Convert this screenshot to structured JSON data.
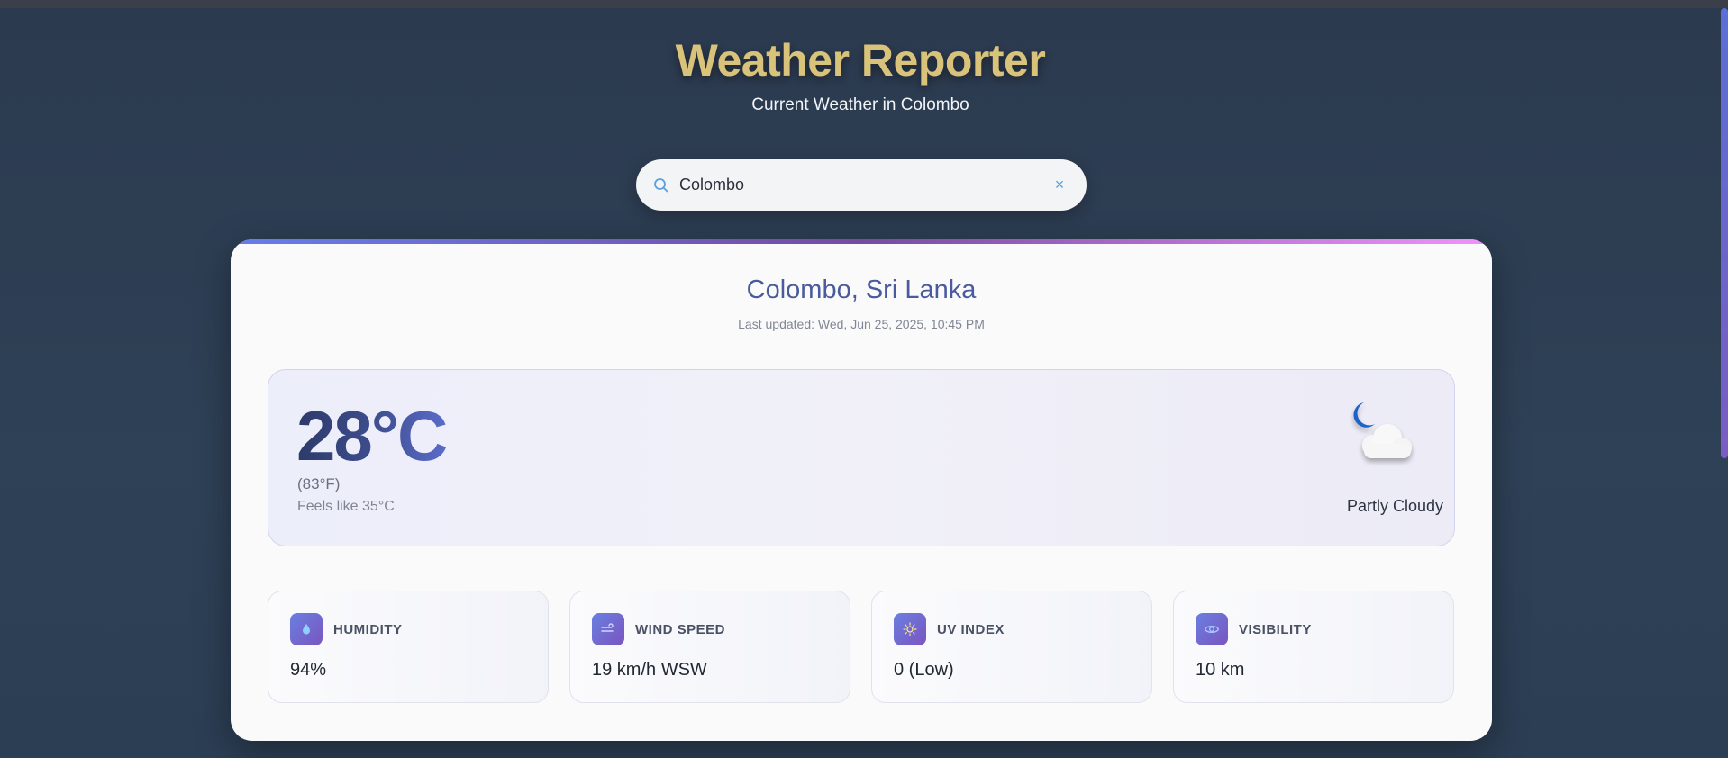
{
  "header": {
    "title": "Weather Reporter",
    "subtitle": "Current Weather in Colombo"
  },
  "search": {
    "value": "Colombo",
    "placeholder": "",
    "clear_label": "×"
  },
  "location": {
    "name": "Colombo, Sri Lanka",
    "last_updated": "Last updated: Wed, Jun 25, 2025, 10:45 PM"
  },
  "current": {
    "temperature": "28°C",
    "temperature_f": "(83°F)",
    "feels_like": "Feels like 35°C",
    "condition": "Partly Cloudy",
    "condition_icon": "moon-cloud-icon"
  },
  "stats": [
    {
      "label": "HUMIDITY",
      "value": "94%",
      "icon": "droplet-icon"
    },
    {
      "label": "WIND SPEED",
      "value": "19 km/h WSW",
      "icon": "wind-icon"
    },
    {
      "label": "UV INDEX",
      "value": "0 (Low)",
      "icon": "sun-icon"
    },
    {
      "label": "VISIBILITY",
      "value": "10 km",
      "icon": "eye-icon"
    }
  ],
  "colors": {
    "accent": "#667eea",
    "accent_secondary": "#764ba2",
    "title_gold": "#d9c27a",
    "background": "#2e4156"
  }
}
